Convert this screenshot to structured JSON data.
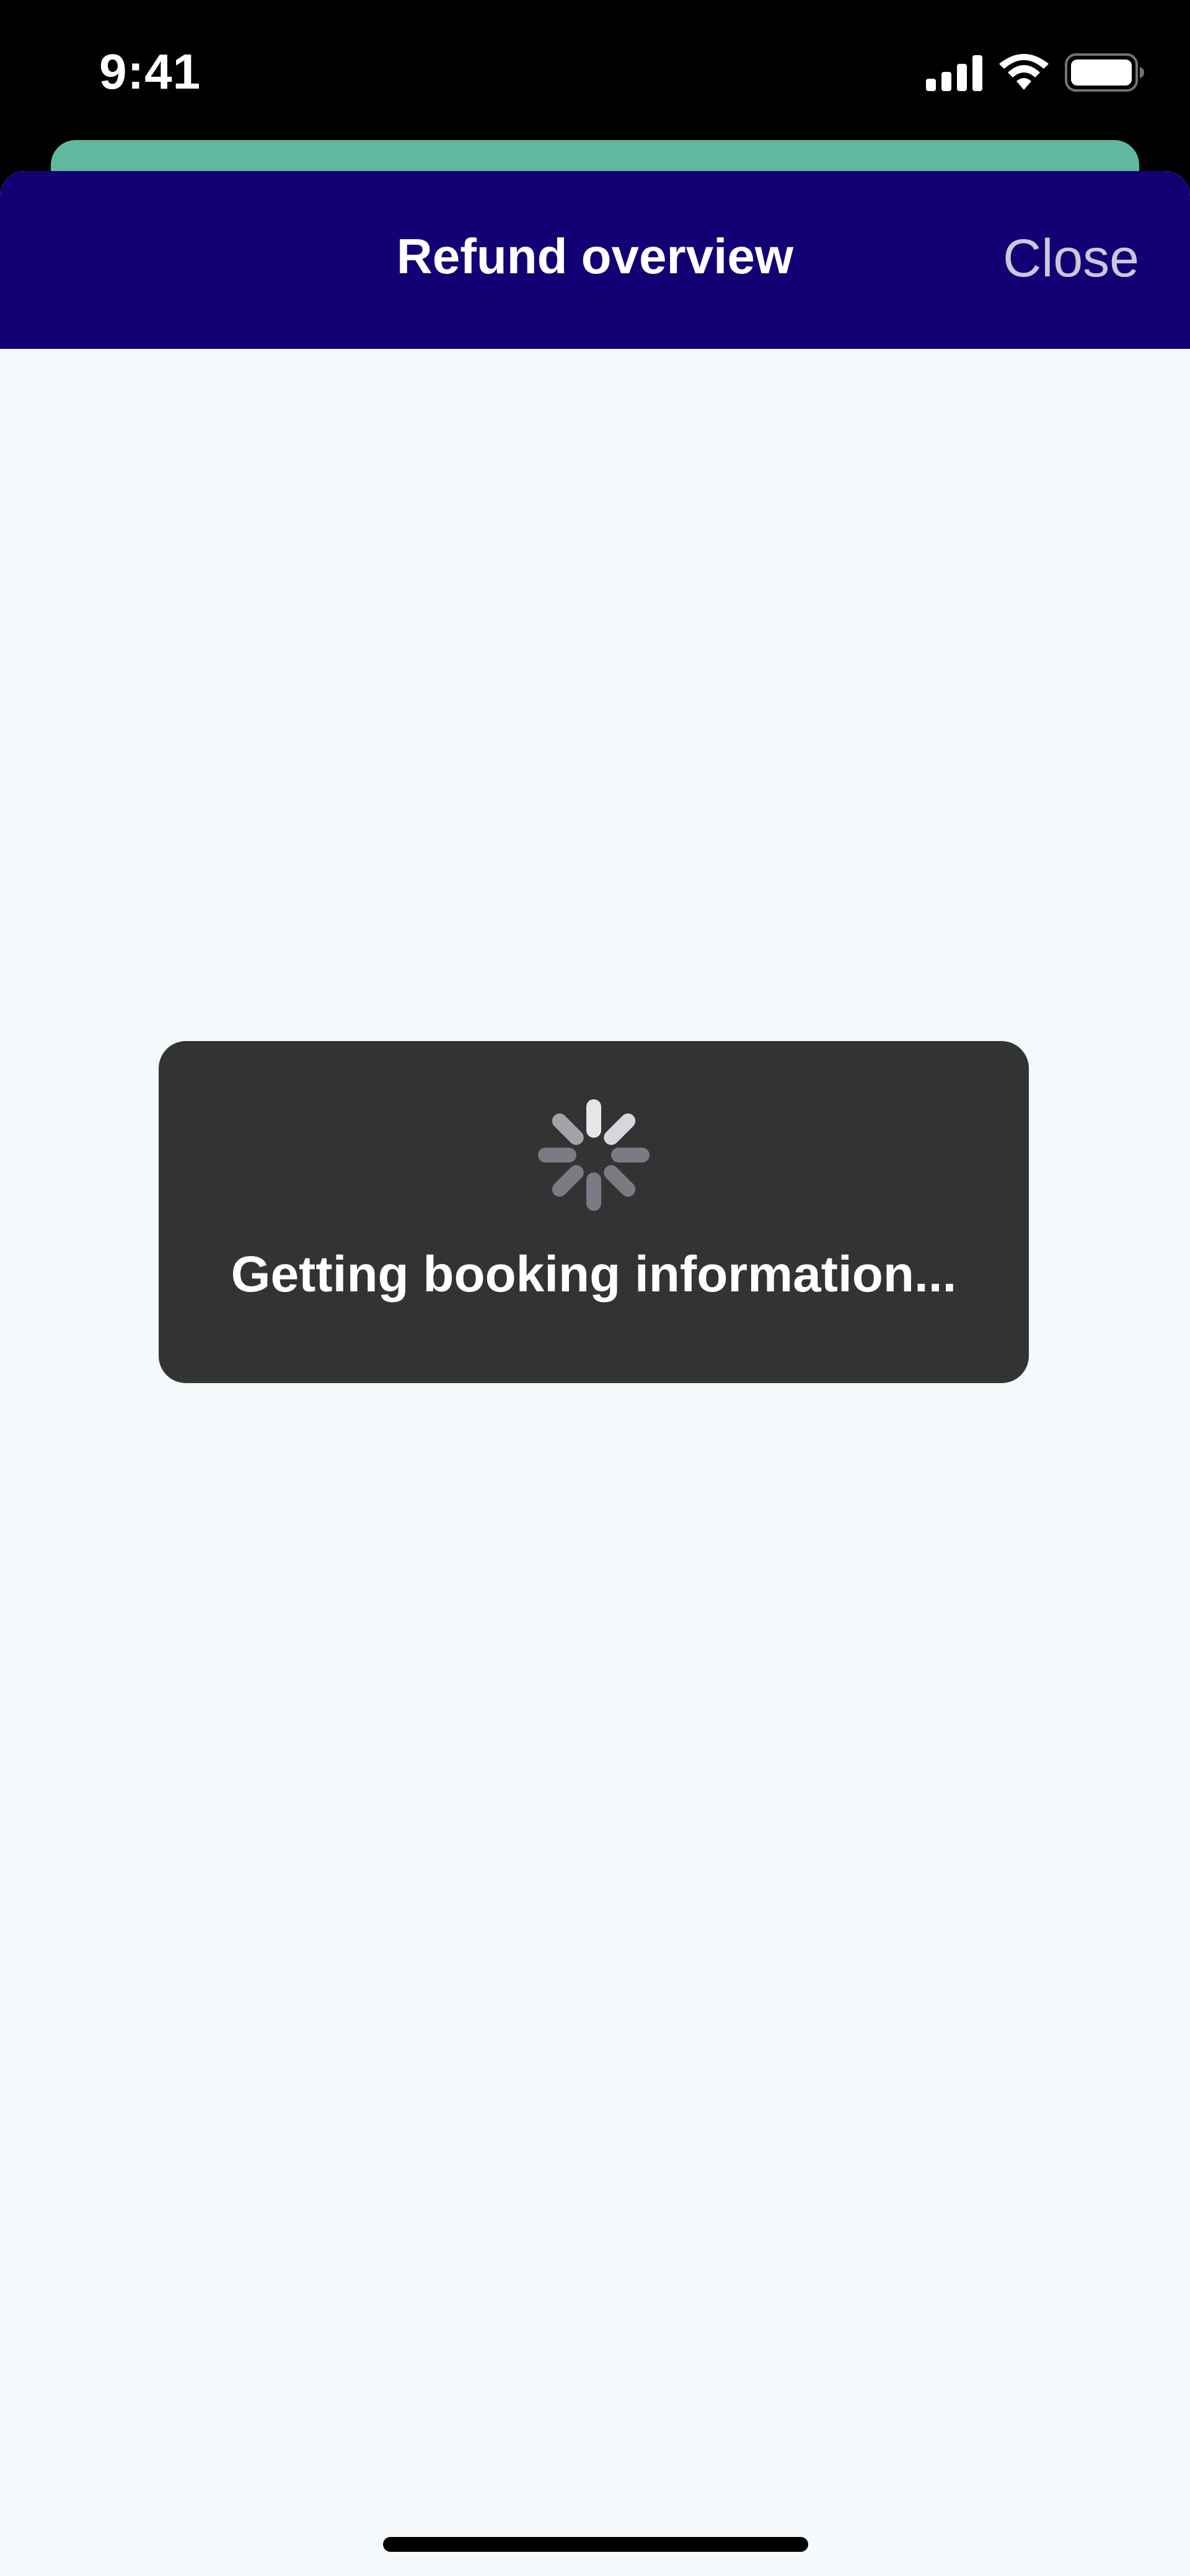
{
  "status_bar": {
    "time": "9:41",
    "icons": [
      "cellular-signal-icon",
      "wifi-icon",
      "battery-icon"
    ]
  },
  "nav": {
    "title": "Refund overview",
    "close_label": "Close"
  },
  "loading": {
    "message": "Getting booking information...",
    "icon": "activity-spinner-icon"
  },
  "colors": {
    "nav_background": "#140074",
    "sheet_background": "#f6f9fc",
    "behind_card": "#62b89f",
    "hud_background": "#323333",
    "close_text": "#c9c9dd"
  }
}
